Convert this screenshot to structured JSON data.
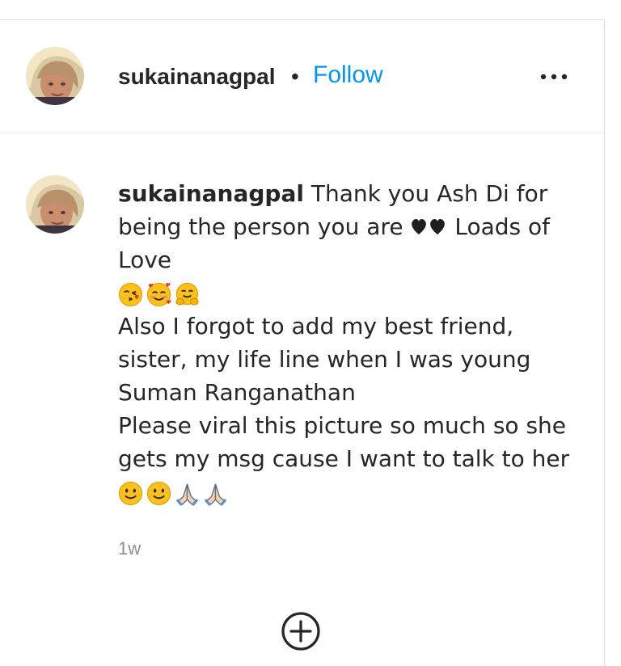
{
  "post": {
    "username": "sukainanagpal",
    "separator": "•",
    "follow_label": "Follow",
    "more_icon": "more-horizontal-icon"
  },
  "comment": {
    "username": "sukainanagpal",
    "line1": "Thank you Ash Di for",
    "line2_a": "being the person you are",
    "line2_b": "Loads of",
    "line3": "Love",
    "line5": "Also I forgot to add my best friend,",
    "line6": "sister, my life line when I was young",
    "line7": "Suman Ranganathan",
    "line8": "Please viral this picture so much so she",
    "line9": "gets my msg cause I want to talk to her",
    "emojis_row1": [
      "kissing-face-emoji",
      "smiling-face-with-hearts-emoji",
      "hugging-face-emoji"
    ],
    "emojis_row2": [
      "smiling-face-emoji",
      "smiling-face-emoji",
      "folded-hands-emoji",
      "folded-hands-emoji"
    ],
    "inline_icons": [
      "black-heart-emoji",
      "black-heart-emoji"
    ],
    "timestamp": "1w"
  },
  "actions": {
    "add_icon": "add-circle-icon"
  },
  "colors": {
    "link": "#0095f6",
    "text": "#262626",
    "muted": "#8e8e8e",
    "border": "#dbdbdb"
  }
}
